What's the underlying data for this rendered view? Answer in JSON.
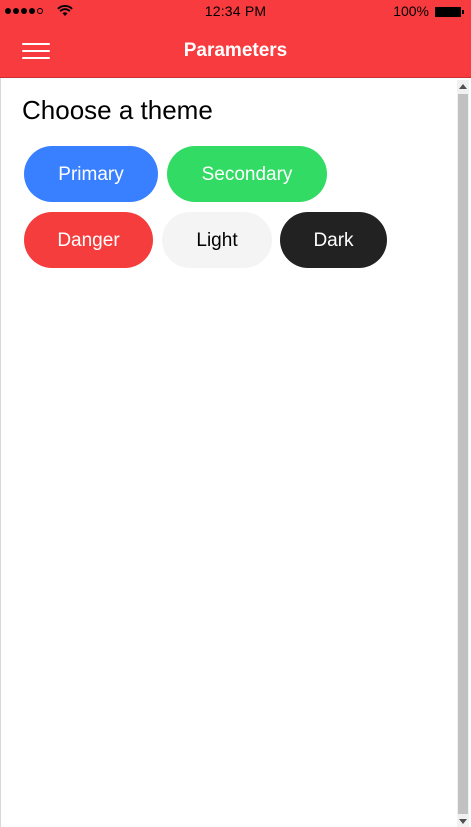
{
  "status_bar": {
    "time": "12:34 PM",
    "battery": "100%",
    "signal_icon": "signal-strength-icon",
    "wifi_icon": "wifi-icon",
    "battery_icon": "battery-icon"
  },
  "header": {
    "title": "Parameters",
    "menu_icon": "hamburger-menu-icon",
    "color": "#f73b3f"
  },
  "main": {
    "title": "Choose a theme",
    "themes": [
      {
        "label": "Primary",
        "color": "#3880ff",
        "text_color": "#ffffff"
      },
      {
        "label": "Secondary",
        "color": "#32db64",
        "text_color": "#ffffff"
      },
      {
        "label": "Danger",
        "color": "#f53d3d",
        "text_color": "#ffffff"
      },
      {
        "label": "Light",
        "color": "#f4f4f4",
        "text_color": "#000000"
      },
      {
        "label": "Dark",
        "color": "#222222",
        "text_color": "#ffffff"
      }
    ]
  }
}
